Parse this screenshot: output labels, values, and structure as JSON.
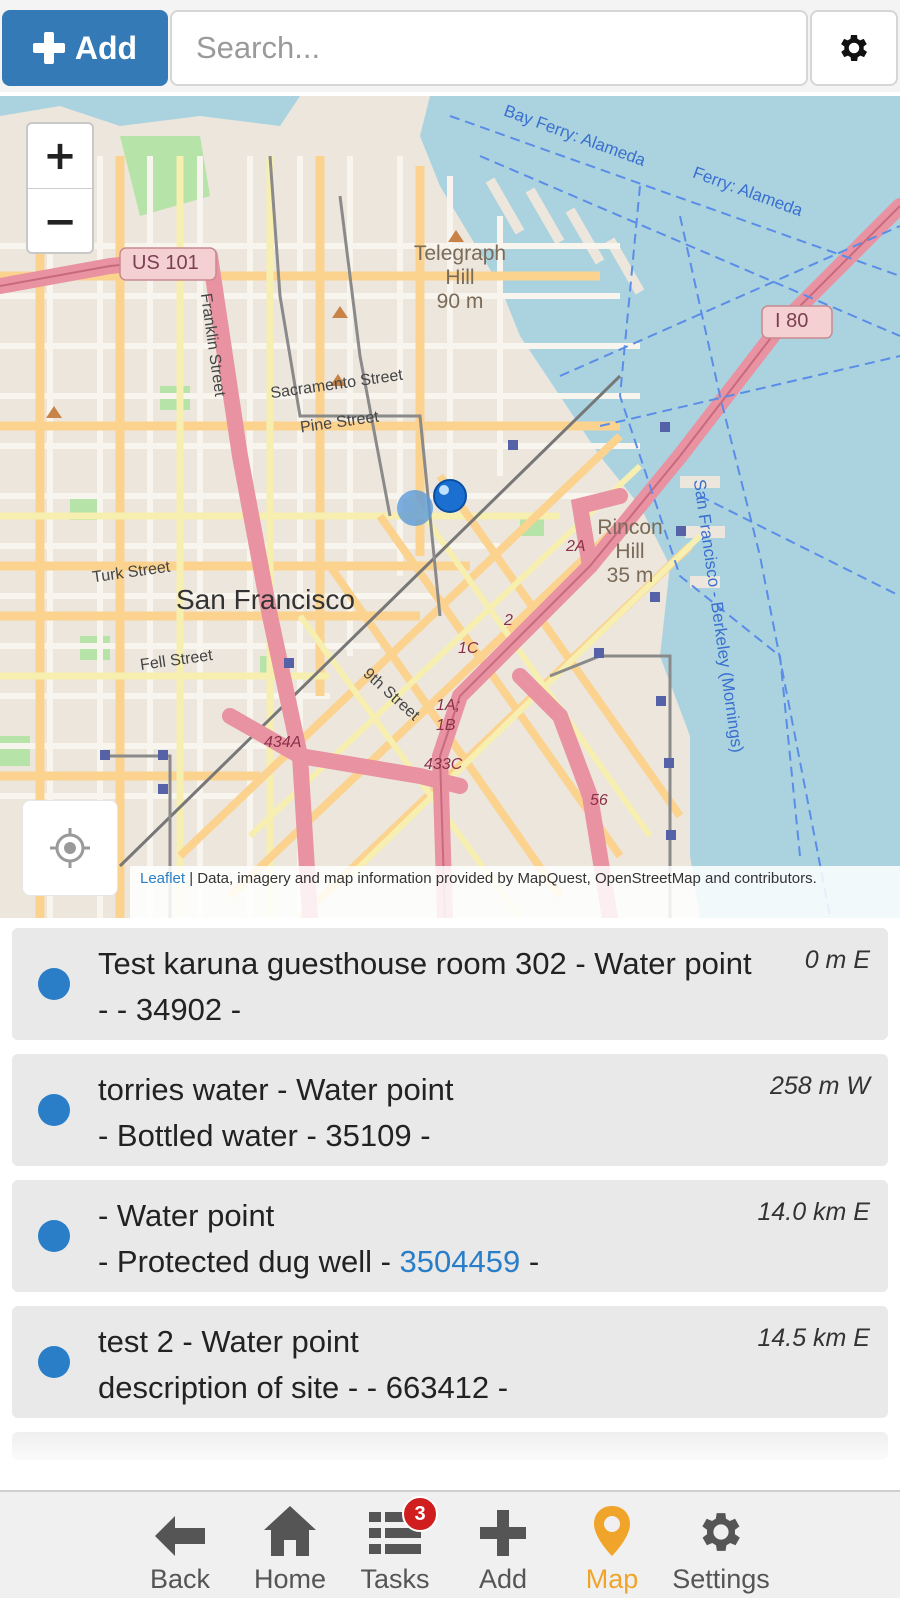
{
  "toolbar": {
    "add_label": "Add",
    "search_placeholder": "Search..."
  },
  "map": {
    "zoom_in": "+",
    "zoom_out": "−",
    "attribution_link": "Leaflet",
    "attribution_text": " | Data, imagery and map information provided by MapQuest, OpenStreetMap and contributors.",
    "labels": {
      "city": "San Francisco",
      "telegraph_hill": "Telegraph Hill",
      "telegraph_elev": "90 m",
      "rincon_hill": "Rincon Hill",
      "rincon_elev": "35 m",
      "us101": "US 101",
      "i80": "I 80",
      "sacramento": "Sacramento Street",
      "pine": "Pine Street",
      "turk": "Turk Street",
      "fell": "Fell Street",
      "franklin": "Franklin Street",
      "ninth": "9th Street",
      "ferry1": "Bay Ferry: Alameda",
      "ferry2": "Ferry: Alameda",
      "ferry3": "San Francisco - Berkeley (Mornings)",
      "exit_2a": "2A",
      "exit_2": "2",
      "exit_1c": "1C",
      "exit_1a": "1A; 1B",
      "exit_433c": "433C",
      "exit_434a": "434A",
      "exit_56": "56"
    }
  },
  "items": [
    {
      "title": "Test karuna guesthouse room 302 - Water point",
      "line2_pre": "- - 34902 -",
      "link": "",
      "line2_post": "",
      "distance": "0 m E"
    },
    {
      "title": "torries water - Water point",
      "line2_pre": "- Bottled water - 35109 -",
      "link": "",
      "line2_post": "",
      "distance": "258 m W"
    },
    {
      "title": "- Water point",
      "line2_pre": "- Protected dug well - ",
      "link": "3504459",
      "line2_post": " -",
      "distance": "14.0 km E"
    },
    {
      "title": "test 2 - Water point",
      "line2_pre": "description of site - - 663412 -",
      "link": "",
      "line2_post": "",
      "distance": "14.5 km E"
    }
  ],
  "nav": {
    "back": "Back",
    "home": "Home",
    "tasks": "Tasks",
    "tasks_badge": "3",
    "add": "Add",
    "map": "Map",
    "settings": "Settings"
  },
  "colors": {
    "accent": "#337ab7",
    "marker": "#2a7ec8",
    "active_nav": "#f0a52a",
    "badge": "#d01e1e",
    "water": "#aad3df"
  }
}
